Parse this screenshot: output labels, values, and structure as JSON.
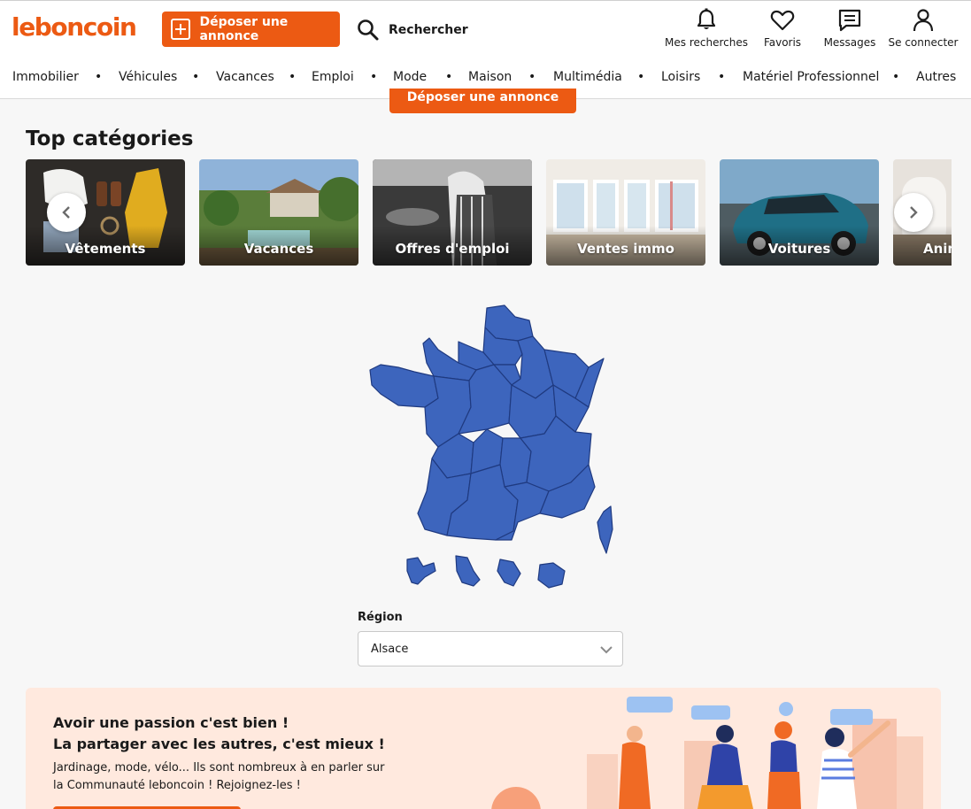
{
  "brand": {
    "logo_text": "leboncoin",
    "accent": "#ec5a13",
    "map_fill": "#3d65bd",
    "map_stroke": "#1f3a80"
  },
  "header": {
    "post_ad_label": "Déposer une annonce",
    "search_label": "Rechercher",
    "icons": [
      {
        "icon": "bell-icon",
        "label": "Mes recherches"
      },
      {
        "icon": "heart-icon",
        "label": "Favoris"
      },
      {
        "icon": "message-icon",
        "label": "Messages"
      },
      {
        "icon": "user-icon",
        "label": "Se connecter"
      }
    ]
  },
  "categories_nav": [
    "Immobilier",
    "Véhicules",
    "Vacances",
    "Emploi",
    "Mode",
    "Maison",
    "Multimédia",
    "Loisirs",
    "Matériel Professionnel",
    "Autres"
  ],
  "top_categories": {
    "peek_button_label": "Déposer une annonce",
    "title": "Top catégories",
    "cards": [
      "Vêtements",
      "Vacances",
      "Offres d'emploi",
      "Ventes immo",
      "Voitures",
      "Animaux"
    ]
  },
  "region_selector": {
    "label": "Région",
    "selected": "Alsace"
  },
  "community_banner": {
    "headline_line1": "Avoir une passion c'est bien !",
    "headline_line2": "La partager avec les autres, c'est mieux !",
    "body": "Jardinage, mode, vélo... Ils sont nombreux à en parler sur la Communauté leboncoin ! Rejoignez-les !"
  }
}
